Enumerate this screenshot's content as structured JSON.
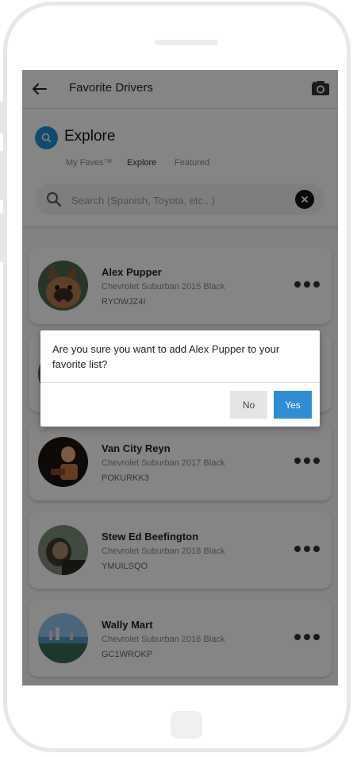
{
  "header": {
    "title": "Favorite Drivers",
    "back_icon": "arrow-left-icon",
    "camera_icon": "camera-icon"
  },
  "explore": {
    "title": "Explore",
    "tabs": [
      {
        "label": "My Faves™",
        "active": false
      },
      {
        "label": "Explore",
        "active": true
      },
      {
        "label": "Featured",
        "active": false
      }
    ],
    "search": {
      "placeholder": "Search (Spanish, Toyota, etc...)",
      "value": ""
    }
  },
  "drivers": [
    {
      "name": "Alex Pupper",
      "car": "Chevrolet Suburban 2015 Black",
      "plate": "RYOWJZ4I"
    },
    {
      "name": "",
      "car": "",
      "plate": ""
    },
    {
      "name": "Van City Reyn",
      "car": "Chevrolet Suburban 2017 Black",
      "plate": "POKURKK3"
    },
    {
      "name": "Stew Ed Beefington",
      "car": "Chevrolet Suburban 2018 Black",
      "plate": "YMUILSQO"
    },
    {
      "name": "Wally Mart",
      "car": "Chevrolet Suburban 2016 Black",
      "plate": "GC1WROKP"
    }
  ],
  "dialog": {
    "message": "Are you sure you want to add  Alex Pupper  to your favorite list?",
    "no_label": "No",
    "yes_label": "Yes"
  },
  "colors": {
    "accent": "#2f8ed1",
    "explore_icon": "#1e8fd6",
    "overlay": "rgba(0,0,0,0.48)"
  }
}
